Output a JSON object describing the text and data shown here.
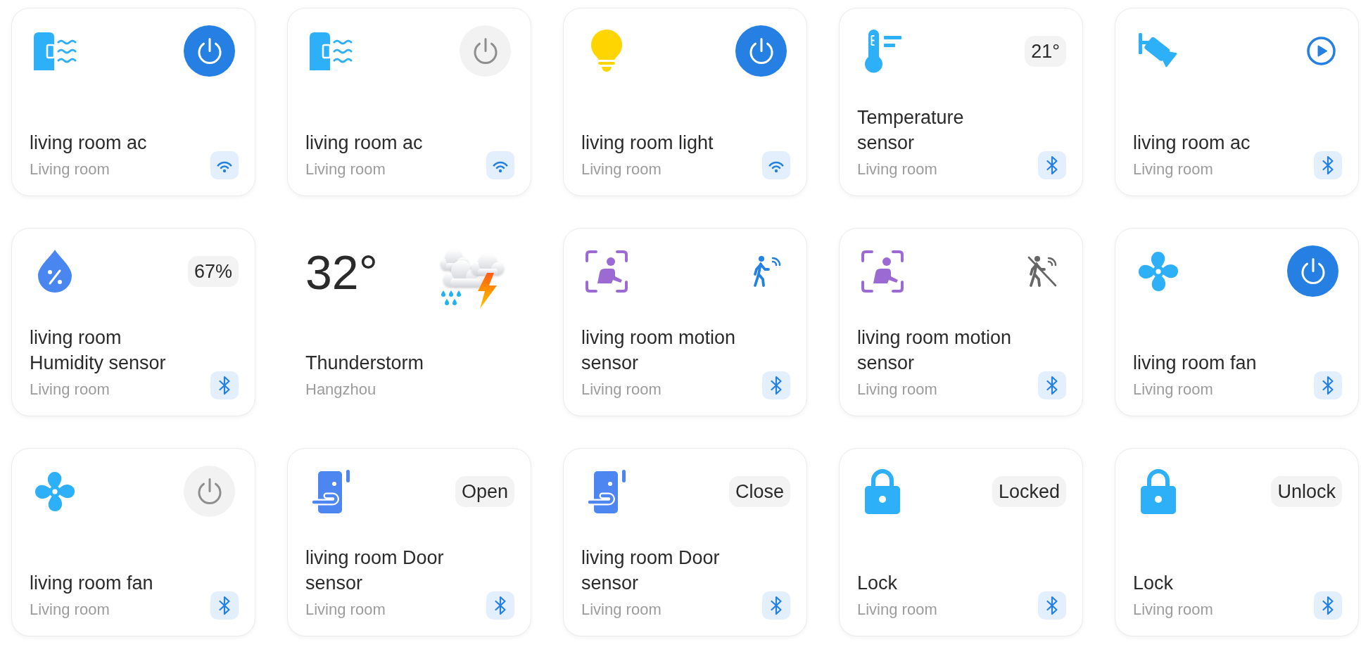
{
  "devices": [
    {
      "kind": "ac",
      "name": "living room ac",
      "room": "Living room",
      "control": {
        "kind": "power",
        "on": true
      },
      "connection": {
        "kind": "wifi"
      }
    },
    {
      "kind": "ac",
      "name": "living room ac",
      "room": "Living room",
      "control": {
        "kind": "power",
        "on": false
      },
      "connection": {
        "kind": "wifi"
      }
    },
    {
      "kind": "light",
      "name": "living room light",
      "room": "Living room",
      "control": {
        "kind": "power",
        "on": true
      },
      "connection": {
        "kind": "wifi"
      }
    },
    {
      "kind": "thermometer",
      "name": "Temperature sensor",
      "room": "Living room",
      "control": {
        "kind": "reading",
        "text": "21°"
      },
      "connection": {
        "kind": "bluetooth"
      }
    },
    {
      "kind": "camera",
      "name": "living room ac",
      "room": "Living room",
      "control": {
        "kind": "play"
      },
      "connection": {
        "kind": "bluetooth"
      }
    },
    {
      "kind": "humidity",
      "name": "living room Humidity sensor",
      "room": "Living room",
      "control": {
        "kind": "reading",
        "text": "67%"
      },
      "connection": {
        "kind": "bluetooth"
      }
    },
    {
      "kind": "weather",
      "temperature": "32°",
      "condition": "Thunderstorm",
      "city": "Hangzhou"
    },
    {
      "kind": "motion",
      "name": "living room motion sensor",
      "room": "Living room",
      "control": {
        "kind": "motion",
        "detected": true
      },
      "connection": {
        "kind": "bluetooth"
      }
    },
    {
      "kind": "motion",
      "name": "living room motion sensor",
      "room": "Living room",
      "control": {
        "kind": "motion",
        "detected": false
      },
      "connection": {
        "kind": "bluetooth"
      }
    },
    {
      "kind": "fan",
      "name": "living room fan",
      "room": "Living room",
      "control": {
        "kind": "power",
        "on": true
      },
      "connection": {
        "kind": "bluetooth"
      }
    },
    {
      "kind": "fan",
      "name": "living room fan",
      "room": "Living room",
      "control": {
        "kind": "power",
        "on": false
      },
      "connection": {
        "kind": "bluetooth"
      }
    },
    {
      "kind": "door",
      "name": "living room Door sensor",
      "room": "Living room",
      "control": {
        "kind": "reading",
        "text": "Open"
      },
      "connection": {
        "kind": "bluetooth"
      }
    },
    {
      "kind": "door",
      "name": "living room Door sensor",
      "room": "Living room",
      "control": {
        "kind": "reading",
        "text": "Close"
      },
      "connection": {
        "kind": "bluetooth"
      }
    },
    {
      "kind": "lock",
      "name": "Lock",
      "room": "Living room",
      "control": {
        "kind": "reading",
        "text": "Locked"
      },
      "connection": {
        "kind": "bluetooth"
      }
    },
    {
      "kind": "lock",
      "name": "Lock",
      "room": "Living room",
      "control": {
        "kind": "reading",
        "text": "Unlock"
      },
      "connection": {
        "kind": "bluetooth"
      }
    }
  ]
}
